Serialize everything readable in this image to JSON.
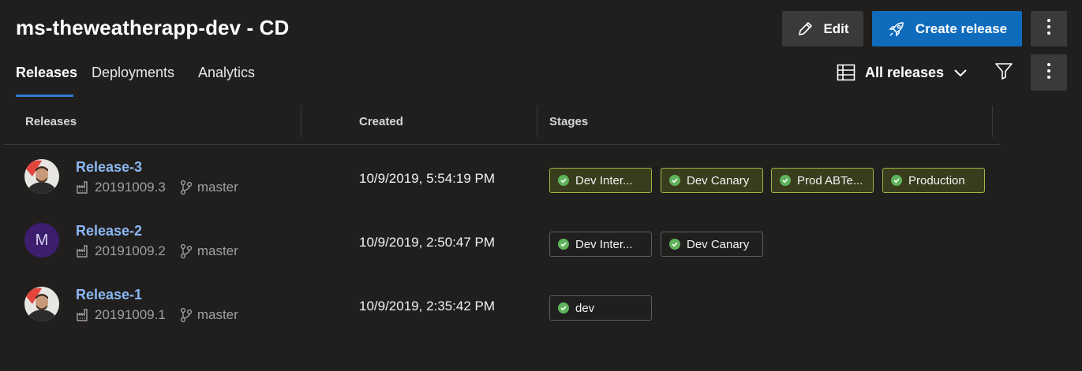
{
  "header": {
    "title": "ms-theweatherapp-dev - CD",
    "edit_label": "Edit",
    "create_release_label": "Create release"
  },
  "tabs": [
    {
      "label": "Releases",
      "selected": true
    },
    {
      "label": "Deployments",
      "selected": false
    },
    {
      "label": "Analytics",
      "selected": false
    }
  ],
  "view_picker": {
    "label": "All releases"
  },
  "table": {
    "columns": [
      "Releases",
      "Created",
      "Stages"
    ],
    "rows": [
      {
        "name": "Release-3",
        "build": "20191009.3",
        "branch": "master",
        "created": "10/9/2019, 5:54:19 PM",
        "avatar": "photo",
        "stages": [
          {
            "label": "Dev Inter...",
            "status": "succeeded",
            "highlight": true
          },
          {
            "label": "Dev Canary",
            "status": "succeeded",
            "highlight": true
          },
          {
            "label": "Prod ABTe...",
            "status": "succeeded",
            "highlight": true
          },
          {
            "label": "Production",
            "status": "succeeded",
            "highlight": true
          }
        ]
      },
      {
        "name": "Release-2",
        "build": "20191009.2",
        "branch": "master",
        "created": "10/9/2019, 2:50:47 PM",
        "avatar": "initial",
        "avatar_initial": "M",
        "stages": [
          {
            "label": "Dev Inter...",
            "status": "succeeded",
            "highlight": false
          },
          {
            "label": "Dev Canary",
            "status": "succeeded",
            "highlight": false
          }
        ]
      },
      {
        "name": "Release-1",
        "build": "20191009.1",
        "branch": "master",
        "created": "10/9/2019, 2:35:42 PM",
        "avatar": "photo",
        "stages": [
          {
            "label": "dev",
            "status": "succeeded",
            "highlight": false
          }
        ]
      }
    ]
  },
  "colors": {
    "background": "#201f1e",
    "accent": "#0f6cbd",
    "link": "#8bb8f2",
    "success": "#5fb35a",
    "stage_highlight_bg": "#393d1d",
    "stage_highlight_border": "#a3b347"
  },
  "icons": {
    "edit": "pencil-icon",
    "create": "rocket-icon",
    "more": "more-vertical-icon",
    "view": "table-view-icon",
    "chevron": "chevron-down-icon",
    "filter": "filter-icon",
    "build": "build-icon",
    "branch": "branch-icon",
    "stage_status": "check-circle-icon"
  }
}
